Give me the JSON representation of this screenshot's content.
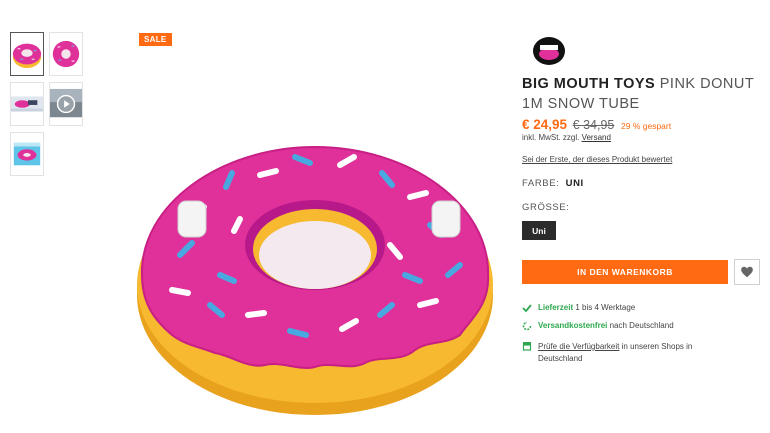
{
  "badge": {
    "sale": "SALE"
  },
  "thumbnails": [
    {
      "name": "donut-front",
      "active": true
    },
    {
      "name": "donut-top"
    },
    {
      "name": "snow-photo"
    },
    {
      "name": "video",
      "icon": "play-icon"
    },
    {
      "name": "packaging"
    }
  ],
  "brand_logo": {
    "text": "BIGMOUTH",
    "sub": "INC."
  },
  "product": {
    "brand": "BIG MOUTH TOYS",
    "name": "PINK DONUT 1M SNOW TUBE"
  },
  "price": {
    "current": "€ 24,95",
    "old": "€ 34,95",
    "saved": "29 % gespart",
    "tax_prefix": "inkl. MwSt. zzgl.",
    "shipping_link": "Versand"
  },
  "review_link": "Sei der Erste, der dieses Produkt bewertet",
  "attributes": {
    "color_label": "FARBE:",
    "color_value": "UNI",
    "size_label": "GRÖSSE:",
    "size_option": "Uni"
  },
  "actions": {
    "add_to_cart": "IN DEN WARENKORB",
    "wishlist_icon": "heart-icon"
  },
  "info": {
    "delivery_label": "Lieferzeit",
    "delivery_text": "1 bis 4 Werktage",
    "shipping_label": "Versandkostenfrei",
    "shipping_text": "nach Deutschland",
    "stores_link": "Prüfe die Verfügbarkeit",
    "stores_text": "in unseren Shops in Deutschland"
  },
  "colors": {
    "accent": "#ff6a13",
    "success": "#2fa84f",
    "dark": "#2b2b2b",
    "donut_pink": "#e0309a",
    "donut_base": "#f6b92f"
  }
}
